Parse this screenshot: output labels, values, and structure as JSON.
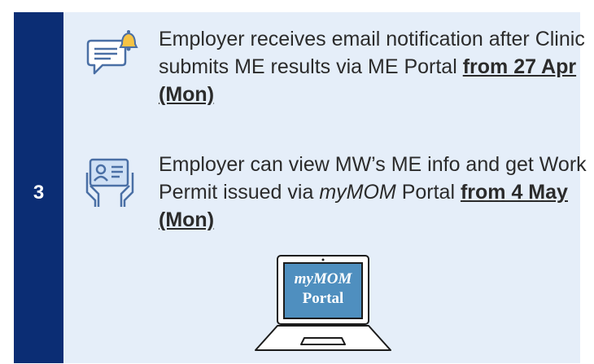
{
  "step": {
    "number": "3"
  },
  "items": [
    {
      "icon": "chat-bell-icon",
      "text": "Employer receives email notification after Clinic submits ME results via ME Portal",
      "date": "from 27 Apr (Mon)"
    },
    {
      "icon": "id-card-hands-icon",
      "text_before": "Employer can view MW’s ME info and get Work Permit issued via",
      "text_italic": "myMOM",
      "text_after": "Portal",
      "date": "from 4 May (Mon)"
    }
  ],
  "laptop": {
    "line1": "myMOM",
    "line2": "Portal"
  },
  "colors": {
    "panel": "#e5eef9",
    "bar": "#0b2d74",
    "screen": "#4f8fbf",
    "icon": "#4a6fa5"
  }
}
